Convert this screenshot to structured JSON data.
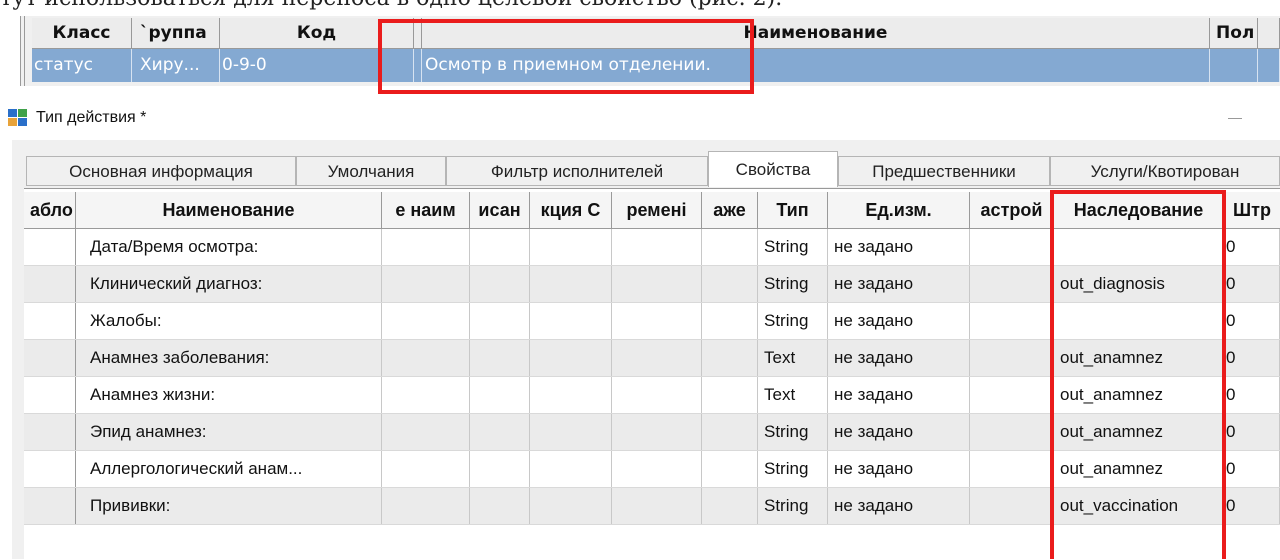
{
  "doc": {
    "line": "тут использоваться для переноса в одно целевой свойство (рис. 2)."
  },
  "top_grid": {
    "headers": [
      "Класс",
      "`руппа",
      "Код",
      "",
      "На",
      "именование",
      "Пол"
    ],
    "row": [
      "статус",
      "Хиру...",
      "0-9-0",
      "Осмотр в приемном отделении."
    ]
  },
  "window": {
    "title": "Тип действия *"
  },
  "tabs": [
    {
      "label": "Основная информация",
      "active": false
    },
    {
      "label": "Умолчания",
      "active": false
    },
    {
      "label": "Фильтр исполнителей",
      "active": false
    },
    {
      "label": "Свойства",
      "active": true
    },
    {
      "label": "Предшественники",
      "active": false
    },
    {
      "label": "Услуги/Квотирован",
      "active": false
    }
  ],
  "grid": {
    "headers": [
      "абло",
      "Наименование",
      "е наим",
      "исан",
      "кция С",
      "ремені",
      "аже",
      "Тип",
      "Ед.изм.",
      "астрой",
      "Наследование",
      "Штр"
    ],
    "rows": [
      {
        "name": "Дата/Время осмотра:",
        "type": "String",
        "unit": "не задано",
        "inherit": "",
        "code": "0"
      },
      {
        "name": "Клинический диагноз:",
        "type": "String",
        "unit": "не задано",
        "inherit": "out_diagnosis",
        "code": "0"
      },
      {
        "name": "Жалобы:",
        "type": "String",
        "unit": "не задано",
        "inherit": "",
        "code": "0"
      },
      {
        "name": "Анамнез заболевания:",
        "type": "Text",
        "unit": "не задано",
        "inherit": "out_anamnez",
        "code": "0"
      },
      {
        "name": "Анамнез жизни:",
        "type": "Text",
        "unit": "не задано",
        "inherit": "out_anamnez",
        "code": "0"
      },
      {
        "name": "Эпид анамнез:",
        "type": "String",
        "unit": "не задано",
        "inherit": "out_anamnez",
        "code": "0"
      },
      {
        "name": "Аллергологический анам...",
        "type": "String",
        "unit": "не задано",
        "inherit": "out_anamnez",
        "code": "0"
      },
      {
        "name": "Прививки:",
        "type": "String",
        "unit": "не задано",
        "inherit": "out_vaccination",
        "code": "0"
      }
    ]
  },
  "colors": {
    "highlight": "#ea1c1c",
    "selected_row": "#84a9d2"
  }
}
